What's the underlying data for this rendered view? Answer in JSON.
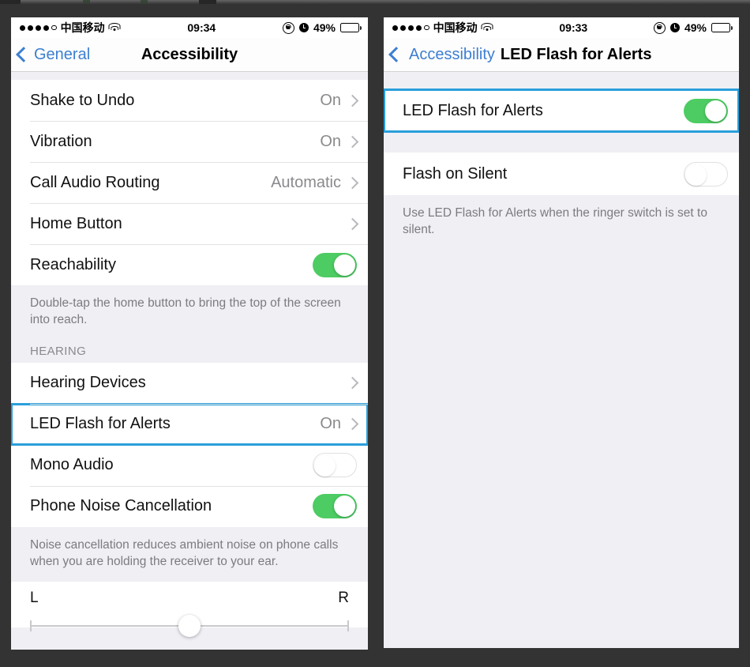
{
  "left_phone": {
    "status_bar": {
      "signal_dots_filled": 4,
      "signal_dots_total": 5,
      "carrier": "中国移动",
      "wifi_icon": "wifi-icon",
      "time": "09:34",
      "rotation_lock_icon": "rotation-lock-icon",
      "alarm_icon": "alarm-clock-icon",
      "battery_percent": "49%",
      "battery_level": 49
    },
    "nav": {
      "back_label": "General",
      "title": "Accessibility",
      "back_chevron_icon": "chevron-left-icon"
    },
    "rows": [
      {
        "label": "Shake to Undo",
        "value": "On",
        "type": "disclosure"
      },
      {
        "label": "Vibration",
        "value": "On",
        "type": "disclosure"
      },
      {
        "label": "Call Audio Routing",
        "value": "Automatic",
        "type": "disclosure"
      },
      {
        "label": "Home Button",
        "value": "",
        "type": "disclosure"
      },
      {
        "label": "Reachability",
        "value": "",
        "type": "switch",
        "on": true
      }
    ],
    "footnote_1": "Double-tap the home button to bring the top of the screen into reach.",
    "section_header": "HEARING",
    "rows2": [
      {
        "label": "Hearing Devices",
        "value": "",
        "type": "disclosure",
        "highlight": false
      },
      {
        "label": "LED Flash for Alerts",
        "value": "On",
        "type": "disclosure",
        "highlight": true
      },
      {
        "label": "Mono Audio",
        "value": "",
        "type": "switch",
        "on": false,
        "highlight": false
      },
      {
        "label": "Phone Noise Cancellation",
        "value": "",
        "type": "switch",
        "on": true,
        "highlight": false
      }
    ],
    "footnote_2": "Noise cancellation reduces ambient noise on phone calls when you are holding the receiver to your ear.",
    "balance": {
      "left_label": "L",
      "right_label": "R",
      "position_percent": 50
    }
  },
  "right_phone": {
    "status_bar": {
      "signal_dots_filled": 4,
      "signal_dots_total": 5,
      "carrier": "中国移动",
      "wifi_icon": "wifi-icon",
      "time": "09:33",
      "rotation_lock_icon": "rotation-lock-icon",
      "alarm_icon": "alarm-clock-icon",
      "battery_percent": "49%",
      "battery_level": 49
    },
    "nav": {
      "back_label": "Accessibility",
      "title": "LED Flash for Alerts",
      "back_chevron_icon": "chevron-left-icon"
    },
    "rows": [
      {
        "label": "LED Flash for Alerts",
        "type": "switch",
        "on": true,
        "highlight": true
      },
      {
        "label": "Flash on Silent",
        "type": "switch",
        "on": false,
        "highlight": false
      }
    ],
    "footnote": "Use LED Flash for Alerts when the ringer switch is set to silent."
  },
  "colors": {
    "accent_blue": "#3d7fd1",
    "highlight_blue": "#2a9fdb",
    "switch_green": "#4ccc62",
    "list_background": "#efeff4",
    "frame": "#333333"
  }
}
